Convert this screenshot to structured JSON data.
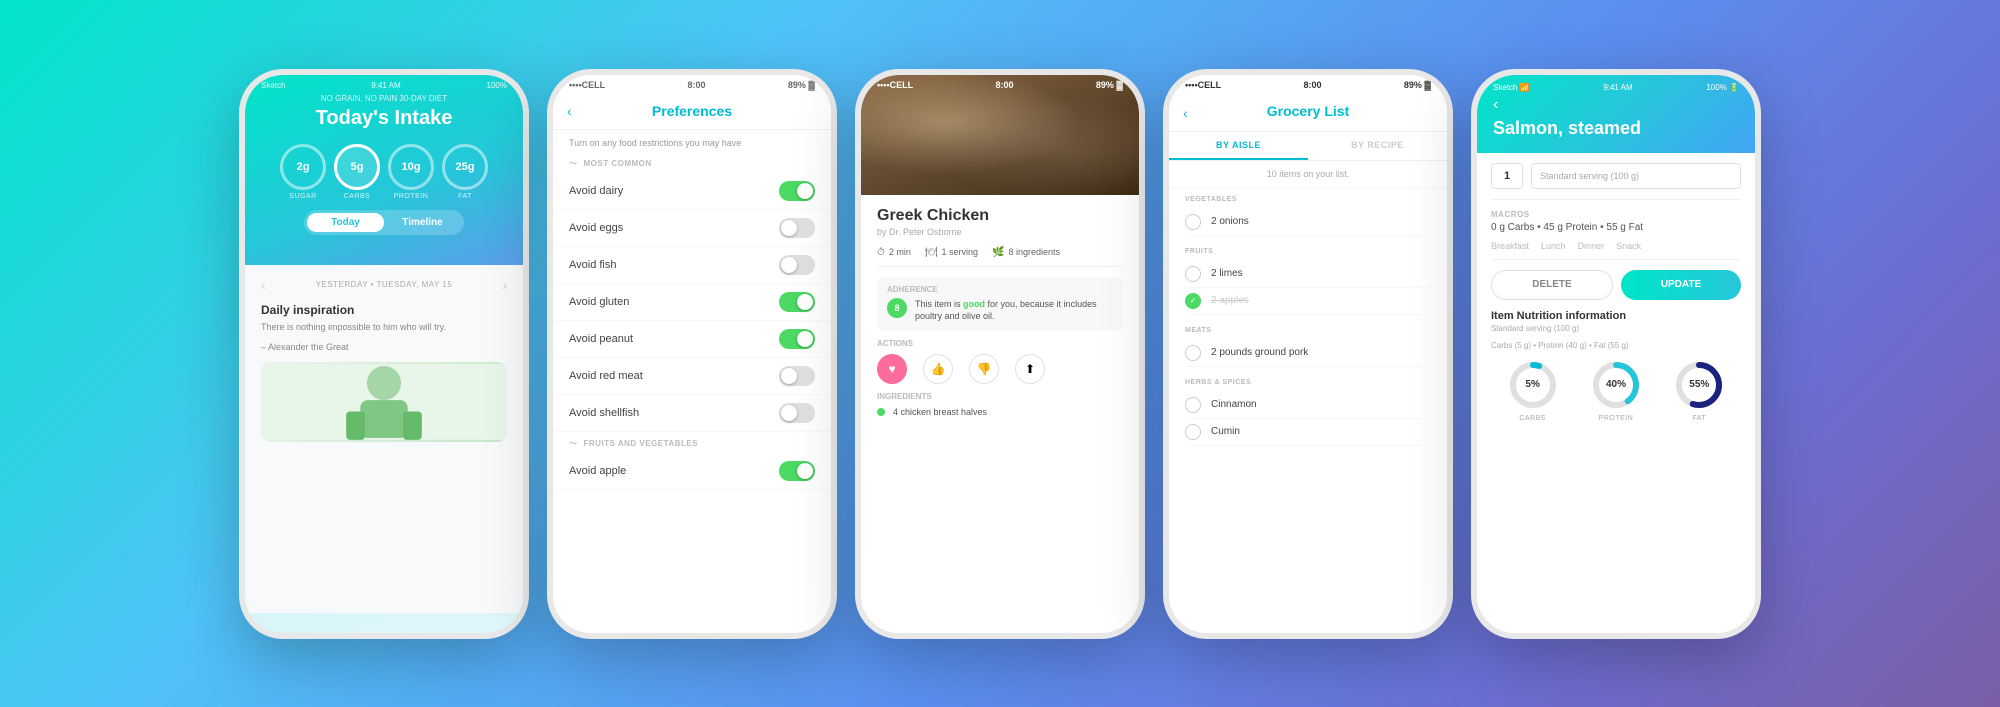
{
  "phone1": {
    "status": {
      "carrier": "Sketch",
      "time": "9:41 AM",
      "battery": "100%"
    },
    "diet_label": "NO GRAIN, NO PAIN 30-DAY DIET",
    "title": "Today's Intake",
    "circles": [
      {
        "value": "2g",
        "label": "SUGAR"
      },
      {
        "value": "5g",
        "label": "CARBS"
      },
      {
        "value": "10g",
        "label": "PROTEIN"
      },
      {
        "value": "25g",
        "label": "FAT"
      }
    ],
    "tabs": [
      "Today",
      "Timeline"
    ],
    "active_tab": 0,
    "nav_date": "YESTERDAY • TUESDAY, MAY 15",
    "inspiration_title": "Daily inspiration",
    "inspiration_text": "There is nothing impossible to him who will try.",
    "inspiration_author": "– Alexander the Great"
  },
  "phone2": {
    "status": {
      "carrier": "••••CELL",
      "wifi": true,
      "time": "8:00",
      "battery": "89%"
    },
    "title": "Preferences",
    "description": "Turn on any food restrictions you may have",
    "sections": [
      {
        "label": "MOST COMMON",
        "items": [
          {
            "label": "Avoid dairy",
            "on": true
          },
          {
            "label": "Avoid eggs",
            "on": false
          },
          {
            "label": "Avoid fish",
            "on": false
          },
          {
            "label": "Avoid gluten",
            "on": true
          },
          {
            "label": "Avoid peanut",
            "on": true
          },
          {
            "label": "Avoid red meat",
            "on": false
          },
          {
            "label": "Avoid shellfish",
            "on": false
          }
        ]
      },
      {
        "label": "FRUITS AND VEGETABLES",
        "items": [
          {
            "label": "Avoid apple",
            "on": true
          }
        ]
      }
    ]
  },
  "phone3": {
    "status": {
      "carrier": "••••CELL",
      "time": "8:00",
      "battery": "89%"
    },
    "recipe_title": "Greek Chicken",
    "recipe_author": "by Dr. Peter Osborne",
    "meta": {
      "time": "2 min",
      "servings": "1 serving",
      "ingredients": "8 ingredients"
    },
    "adherence": {
      "label": "ADHERENCE",
      "score": "8",
      "text": "This item is good for you, because it includes poultry and olive oil."
    },
    "actions_label": "ACTIONS",
    "ingredients_label": "INGREDIENTS",
    "ingredients": [
      "4 chicken breast halves"
    ]
  },
  "phone4": {
    "status": {
      "carrier": "••••CELL",
      "time": "8:00",
      "battery": "89%"
    },
    "title": "Grocery List",
    "tabs": [
      "BY AISLE",
      "BY RECIPE"
    ],
    "active_tab": 0,
    "count_text": "10 items on your list.",
    "sections": [
      {
        "label": "VEGETABLES",
        "items": [
          {
            "label": "2 onions",
            "checked": false
          }
        ]
      },
      {
        "label": "FRUITS",
        "items": [
          {
            "label": "2 limes",
            "checked": false
          },
          {
            "label": "2 apples",
            "checked": true
          }
        ]
      },
      {
        "label": "MEATS",
        "items": [
          {
            "label": "2 pounds ground pork",
            "checked": false
          }
        ]
      },
      {
        "label": "HERBS & SPICES",
        "items": [
          {
            "label": "Cinnamon",
            "checked": false
          },
          {
            "label": "Cumin",
            "checked": false
          }
        ]
      }
    ]
  },
  "phone5": {
    "status": {
      "carrier": "Sketch",
      "time": "9:41 AM",
      "battery": "100%"
    },
    "title": "Salmon, steamed",
    "serving_qty": "1",
    "serving_placeholder": "Standard serving (100 g)",
    "macros_label": "MACROS",
    "macros_text": "0 g Carbs • 45 g Protein • 55 g Fat",
    "meal_tabs": [
      "Breakfast",
      "Lunch",
      "Dinner",
      "Snack"
    ],
    "delete_label": "DELETE",
    "update_label": "UPDATE",
    "nutrition_title": "Item Nutrition information",
    "nutrition_subtitle": "Standard serving (100 g)",
    "nutrition_detail": "Carbs (5 g) • Protein (40 g) • Fat (55 g)",
    "charts": [
      {
        "label": "CARBS",
        "pct": 5,
        "color": "#00bcd4"
      },
      {
        "label": "PROTEIN",
        "pct": 40,
        "color": "#26c6da"
      },
      {
        "label": "FAT",
        "pct": 55,
        "color": "#1a237e"
      }
    ]
  },
  "icons": {
    "back": "‹",
    "forward": "›",
    "heart": "♥",
    "thumbup": "👍",
    "thumbdown": "👎",
    "share": "↑",
    "checkmark": "✓",
    "clock": "⏱",
    "fork": "🍴",
    "leaf": "🌿"
  }
}
